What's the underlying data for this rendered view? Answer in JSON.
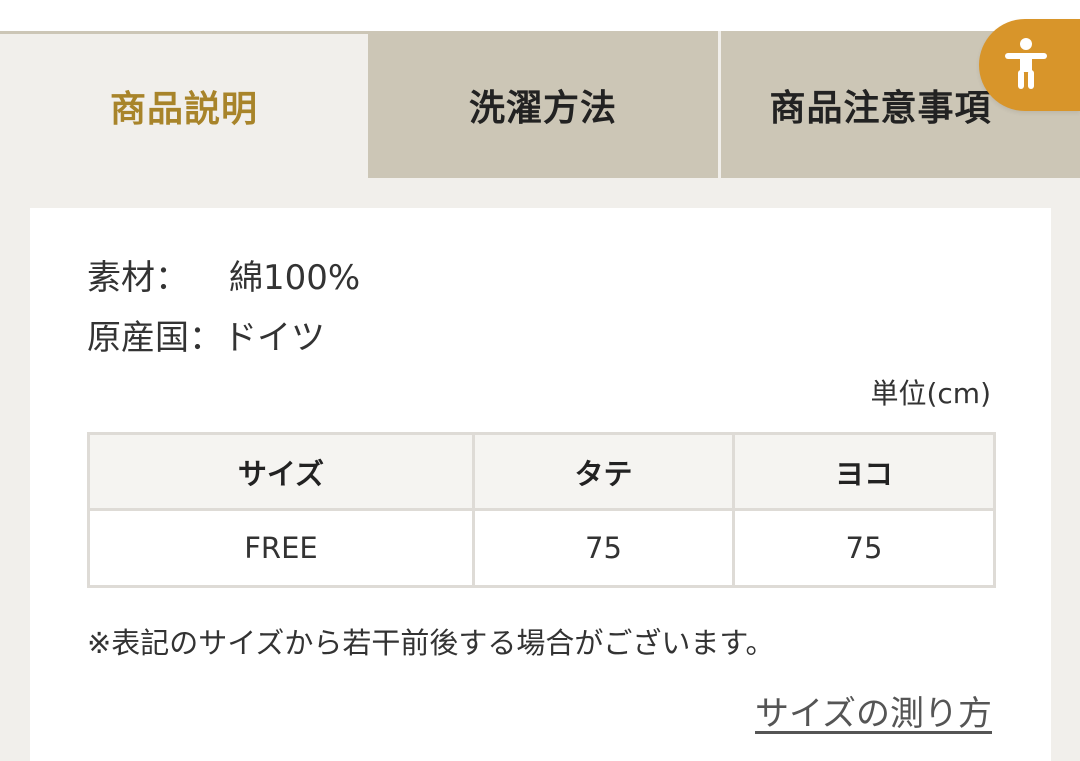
{
  "tabs": [
    {
      "label": "商品説明",
      "active": true
    },
    {
      "label": "洗濯方法",
      "active": false
    },
    {
      "label": "商品注意事項",
      "active": false
    }
  ],
  "specs": {
    "material_label": "素材：",
    "material_value": "綿100%",
    "origin_label": "原産国：",
    "origin_value": "ドイツ"
  },
  "unit": "単位(cm)",
  "size_table": {
    "headers": [
      "サイズ",
      "タテ",
      "ヨコ"
    ],
    "rows": [
      [
        "FREE",
        "75",
        "75"
      ]
    ]
  },
  "note": "※表記のサイズから若干前後する場合がございます。",
  "measure_link": "サイズの測り方",
  "accessibility_button": {
    "icon": "accessibility-icon",
    "color": "#d8952a"
  },
  "colors": {
    "accent": "#a8842a",
    "tab_inactive": "#ccc6b6",
    "panel_bg": "#f1efeb"
  }
}
